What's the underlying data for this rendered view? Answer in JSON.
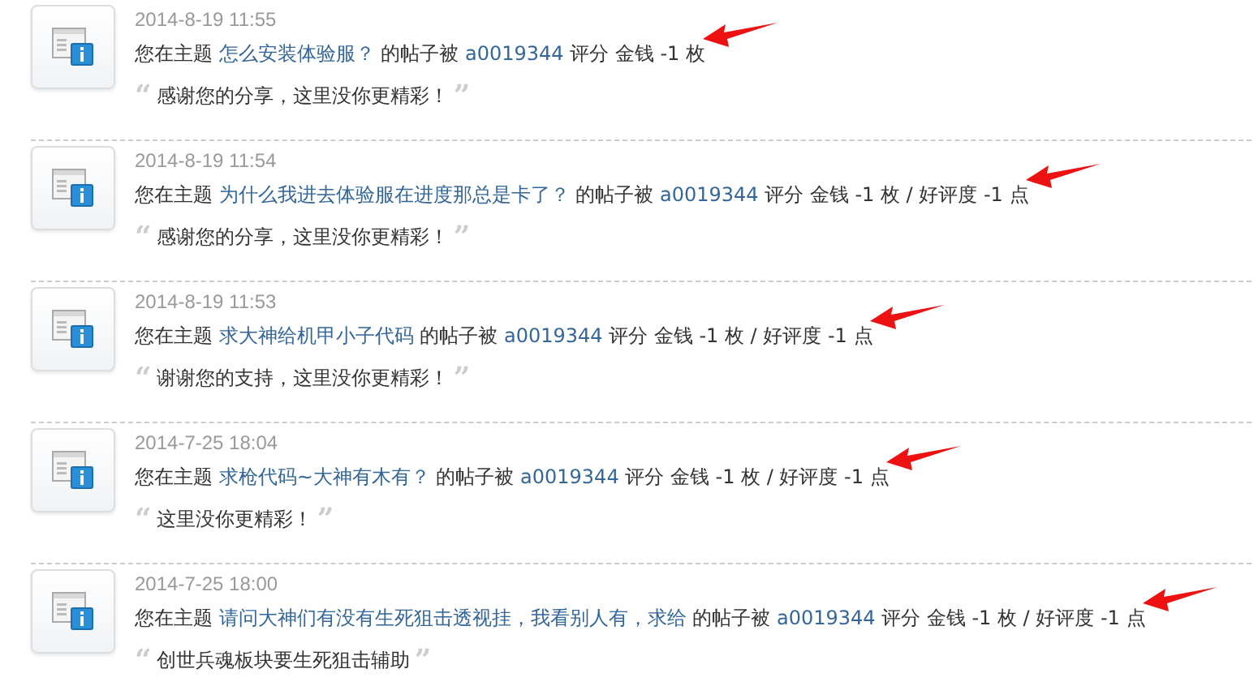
{
  "notices": [
    {
      "time": "2014-8-19 11:55",
      "prefix": "您在主题",
      "topic": "怎么安装体验服？",
      "middle": "的帖子被",
      "user": "a0019344",
      "rating": "评分 金钱 -1 枚",
      "quote": {
        "open": "“",
        "text": "感谢您的分享，这里没你更精彩！",
        "close": "”"
      }
    },
    {
      "time": "2014-8-19 11:54",
      "prefix": "您在主题",
      "topic": "为什么我进去体验服在进度那总是卡了？",
      "middle": "的帖子被",
      "user": "a0019344",
      "rating": "评分 金钱 -1 枚 / 好评度 -1 点",
      "quote": {
        "open": "“",
        "text": "感谢您的分享，这里没你更精彩！",
        "close": "”"
      }
    },
    {
      "time": "2014-8-19 11:53",
      "prefix": "您在主题",
      "topic": "求大神给机甲小子代码",
      "middle": "的帖子被",
      "user": "a0019344",
      "rating": "评分 金钱 -1 枚 / 好评度 -1 点",
      "quote": {
        "open": "“",
        "text": "谢谢您的支持，这里没你更精彩！",
        "close": "”"
      }
    },
    {
      "time": "2014-7-25 18:04",
      "prefix": "您在主题",
      "topic": "求枪代码~大神有木有？",
      "middle": "的帖子被",
      "user": "a0019344",
      "rating": "评分 金钱 -1 枚 / 好评度 -1 点",
      "quote": {
        "open": "“",
        "text": "这里没你更精彩！",
        "close": "”"
      }
    },
    {
      "time": "2014-7-25 18:00",
      "prefix": "您在主题",
      "topic": "请问大神们有没有生死狙击透视挂，我看别人有，求给",
      "middle": "的帖子被",
      "user": "a0019344",
      "rating": "评分 金钱 -1 枚 / 好评度 -1 点",
      "quote": {
        "open": "“",
        "text": "创世兵魂板块要生死狙击辅助",
        "close": "”"
      }
    }
  ]
}
